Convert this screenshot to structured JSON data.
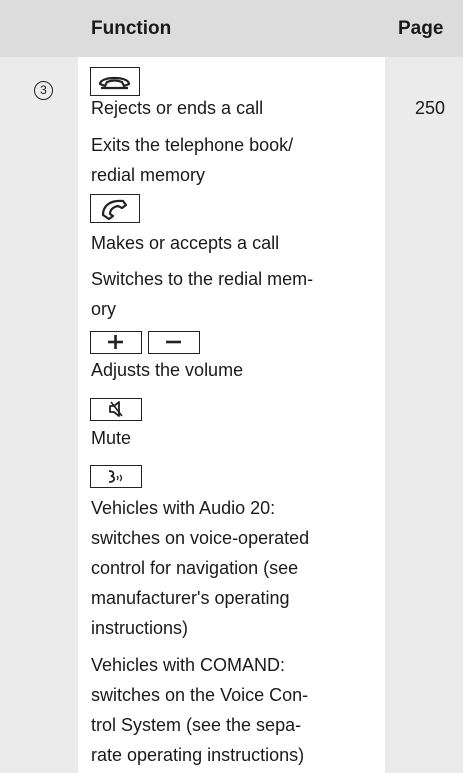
{
  "header": {
    "function_label": "Function",
    "page_label": "Page"
  },
  "row": {
    "number": "3",
    "end_call_icon": "phone-hang-up-icon",
    "end_call_lines": [
      "Rejects or ends a call",
      "Exits the telephone book/",
      "redial memory"
    ],
    "end_call_page": "250",
    "accept_call_icon": "phone-handset-icon",
    "accept_call_lines": [
      "Makes or accepts a call",
      "Switches to the redial mem-",
      "ory"
    ],
    "volume_up_icon": "plus-icon",
    "volume_down_icon": "minus-icon",
    "volume_text": "Adjusts the volume",
    "mute_icon": "speaker-mute-icon",
    "mute_text": "Mute",
    "voice_icon": "voice-control-icon",
    "audio20_lines": [
      "Vehicles with Audio 20:",
      "switches on voice-operated",
      "control for navigation (see",
      "manufacturer's operating",
      "instructions)"
    ],
    "comand_lines": [
      "Vehicles with COMAND:",
      "switches on the Voice Con-",
      "trol System (see the sepa-",
      "rate operating instructions)"
    ]
  }
}
